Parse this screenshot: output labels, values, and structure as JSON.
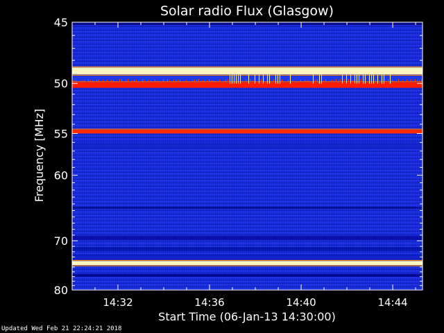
{
  "chart_data": {
    "type": "heatmap",
    "title": "Solar radio Flux (Glasgow)",
    "xlabel": "Start Time (06-Jan-13 14:30:00)",
    "ylabel": "Frequency [MHz]",
    "x_unit": "minutes since start",
    "xlim": [
      0,
      15.3
    ],
    "ylim": [
      45,
      80
    ],
    "y_axis_direction": "downward-increasing",
    "y_scale": "reciprocal",
    "x_ticks": [
      {
        "value": 2,
        "label": "14:32"
      },
      {
        "value": 6,
        "label": "14:36"
      },
      {
        "value": 10,
        "label": "14:40"
      },
      {
        "value": 14,
        "label": "14:44"
      }
    ],
    "y_ticks": [
      {
        "value": 45,
        "label": "45"
      },
      {
        "value": 50,
        "label": "50"
      },
      {
        "value": 55,
        "label": "55"
      },
      {
        "value": 60,
        "label": "60"
      },
      {
        "value": 70,
        "label": "70"
      },
      {
        "value": 80,
        "label": "80"
      }
    ],
    "background_color": "#1a2ee0",
    "emission_bands": [
      {
        "freq_from": 48.6,
        "freq_to": 49.2,
        "level": "very high",
        "color": "#fff6c0"
      },
      {
        "freq_from": 49.9,
        "freq_to": 50.4,
        "level": "high",
        "color": "#ff1a00"
      },
      {
        "freq_from": 54.6,
        "freq_to": 55.0,
        "level": "high",
        "color": "#ff2a00"
      },
      {
        "freq_from": 73.8,
        "freq_to": 74.6,
        "level": "very high",
        "color": "#fff6c0"
      }
    ]
  },
  "footer": "Updated Wed Feb 21 22:24:21 2018"
}
